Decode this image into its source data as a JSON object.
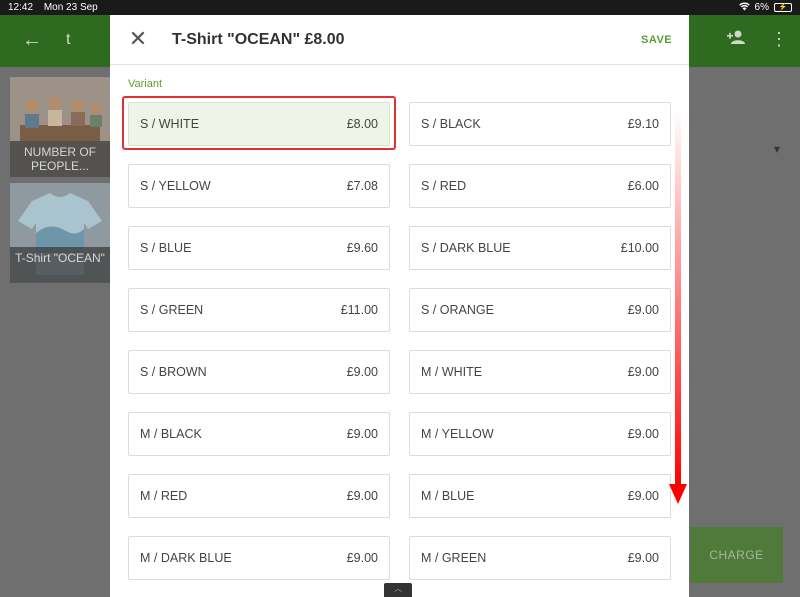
{
  "status_bar": {
    "time": "12:42",
    "date": "Mon 23 Sep",
    "battery": "6%"
  },
  "background": {
    "title": "t",
    "tiles": [
      {
        "caption": "NUMBER OF PEOPLE..."
      },
      {
        "caption": "T-Shirt \"OCEAN\""
      }
    ],
    "charge_label": "CHARGE"
  },
  "modal": {
    "title": "T-Shirt \"OCEAN\" £8.00",
    "save_label": "SAVE",
    "variant_label": "Variant",
    "variants": [
      {
        "name": "S / WHITE",
        "price": "£8.00",
        "selected": true
      },
      {
        "name": "S / BLACK",
        "price": "£9.10"
      },
      {
        "name": "S / YELLOW",
        "price": "£7.08"
      },
      {
        "name": "S / RED",
        "price": "£6.00"
      },
      {
        "name": "S / BLUE",
        "price": "£9.60"
      },
      {
        "name": "S / DARK BLUE",
        "price": "£10.00"
      },
      {
        "name": "S / GREEN",
        "price": "£11.00"
      },
      {
        "name": "S / ORANGE",
        "price": "£9.00"
      },
      {
        "name": "S / BROWN",
        "price": "£9.00"
      },
      {
        "name": "M / WHITE",
        "price": "£9.00"
      },
      {
        "name": "M / BLACK",
        "price": "£9.00"
      },
      {
        "name": "M / YELLOW",
        "price": "£9.00"
      },
      {
        "name": "M / RED",
        "price": "£9.00"
      },
      {
        "name": "M / BLUE",
        "price": "£9.00"
      },
      {
        "name": "M / DARK BLUE",
        "price": "£9.00"
      },
      {
        "name": "M / GREEN",
        "price": "£9.00"
      }
    ]
  },
  "colors": {
    "accent": "#5a9e2f",
    "header_green": "#2e6b21",
    "annotation_red": "#e03030"
  }
}
